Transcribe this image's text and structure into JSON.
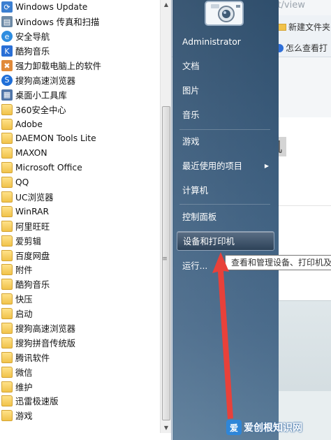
{
  "programs": [
    {
      "label": "Windows Update",
      "icon": "windows-update-icon"
    },
    {
      "label": "Windows 传真和扫描",
      "icon": "fax-scan-icon"
    },
    {
      "label": "安全导航",
      "icon": "ie-icon"
    },
    {
      "label": "酷狗音乐",
      "icon": "kugou-icon"
    },
    {
      "label": "强力卸载电脑上的软件",
      "icon": "uninstall-icon"
    },
    {
      "label": "搜狗高速浏览器",
      "icon": "sogou-browser-icon"
    },
    {
      "label": "桌面小工具库",
      "icon": "gadgets-icon"
    },
    {
      "label": "360安全中心",
      "icon": "folder-icon"
    },
    {
      "label": "Adobe",
      "icon": "folder-icon"
    },
    {
      "label": "DAEMON Tools Lite",
      "icon": "folder-icon"
    },
    {
      "label": "MAXON",
      "icon": "folder-icon"
    },
    {
      "label": "Microsoft Office",
      "icon": "folder-icon"
    },
    {
      "label": "QQ",
      "icon": "folder-icon"
    },
    {
      "label": "UC浏览器",
      "icon": "folder-icon"
    },
    {
      "label": "WinRAR",
      "icon": "folder-icon"
    },
    {
      "label": "阿里旺旺",
      "icon": "folder-icon"
    },
    {
      "label": "爱剪辑",
      "icon": "folder-icon"
    },
    {
      "label": "百度网盘",
      "icon": "folder-icon"
    },
    {
      "label": "附件",
      "icon": "folder-icon"
    },
    {
      "label": "酷狗音乐",
      "icon": "folder-icon"
    },
    {
      "label": "快压",
      "icon": "folder-icon"
    },
    {
      "label": "启动",
      "icon": "folder-icon"
    },
    {
      "label": "搜狗高速浏览器",
      "icon": "folder-icon"
    },
    {
      "label": "搜狗拼音传统版",
      "icon": "folder-icon"
    },
    {
      "label": "腾讯软件",
      "icon": "folder-icon"
    },
    {
      "label": "微信",
      "icon": "folder-icon"
    },
    {
      "label": "维护",
      "icon": "folder-icon"
    },
    {
      "label": "迅雷极速版",
      "icon": "folder-icon"
    },
    {
      "label": "游戏",
      "icon": "folder-icon"
    }
  ],
  "right_menu": {
    "user": "Administrator",
    "documents": "文档",
    "pictures": "图片",
    "music": "音乐",
    "games": "游戏",
    "recent": "最近使用的项目",
    "computer": "计算机",
    "control_panel": "控制面板",
    "devices_printers": "设备和打印机",
    "run": "运行..."
  },
  "tooltip": "查看和管理设备、打印机及",
  "background": {
    "url_fragment": "ellent/view",
    "bookmark_new_folder": "新建文件夹",
    "bookmark_how": "怎么查看打",
    "heading_fragment": "机"
  },
  "watermark": {
    "logo_char": "爱",
    "text": "爱创根知识网"
  },
  "colors": {
    "start_menu_right": "#3d5e7e",
    "highlight": "#2d4258",
    "annotation_arrow": "#e8413a"
  }
}
